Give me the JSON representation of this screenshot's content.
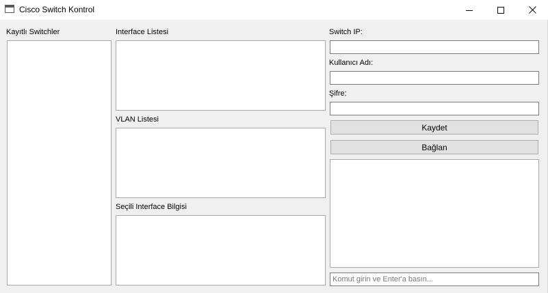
{
  "window": {
    "title": "Cisco Switch Kontrol",
    "icon": "app-window-icon"
  },
  "left_panel": {
    "label": "Kayıtlı Switchler"
  },
  "middle_panel": {
    "interfaces_label": "Interface Listesi",
    "vlans_label": "VLAN Listesi",
    "interface_info_label": "Seçili Interface Bilgisi"
  },
  "right_panel": {
    "switch_ip_label": "Switch IP:",
    "switch_ip_value": "",
    "username_label": "Kullanıcı Adı:",
    "username_value": "",
    "password_label": "Şifre:",
    "password_value": "",
    "save_button": "Kaydet",
    "connect_button": "Bağlan",
    "command_placeholder": "Komut girin ve Enter'a basın..."
  }
}
